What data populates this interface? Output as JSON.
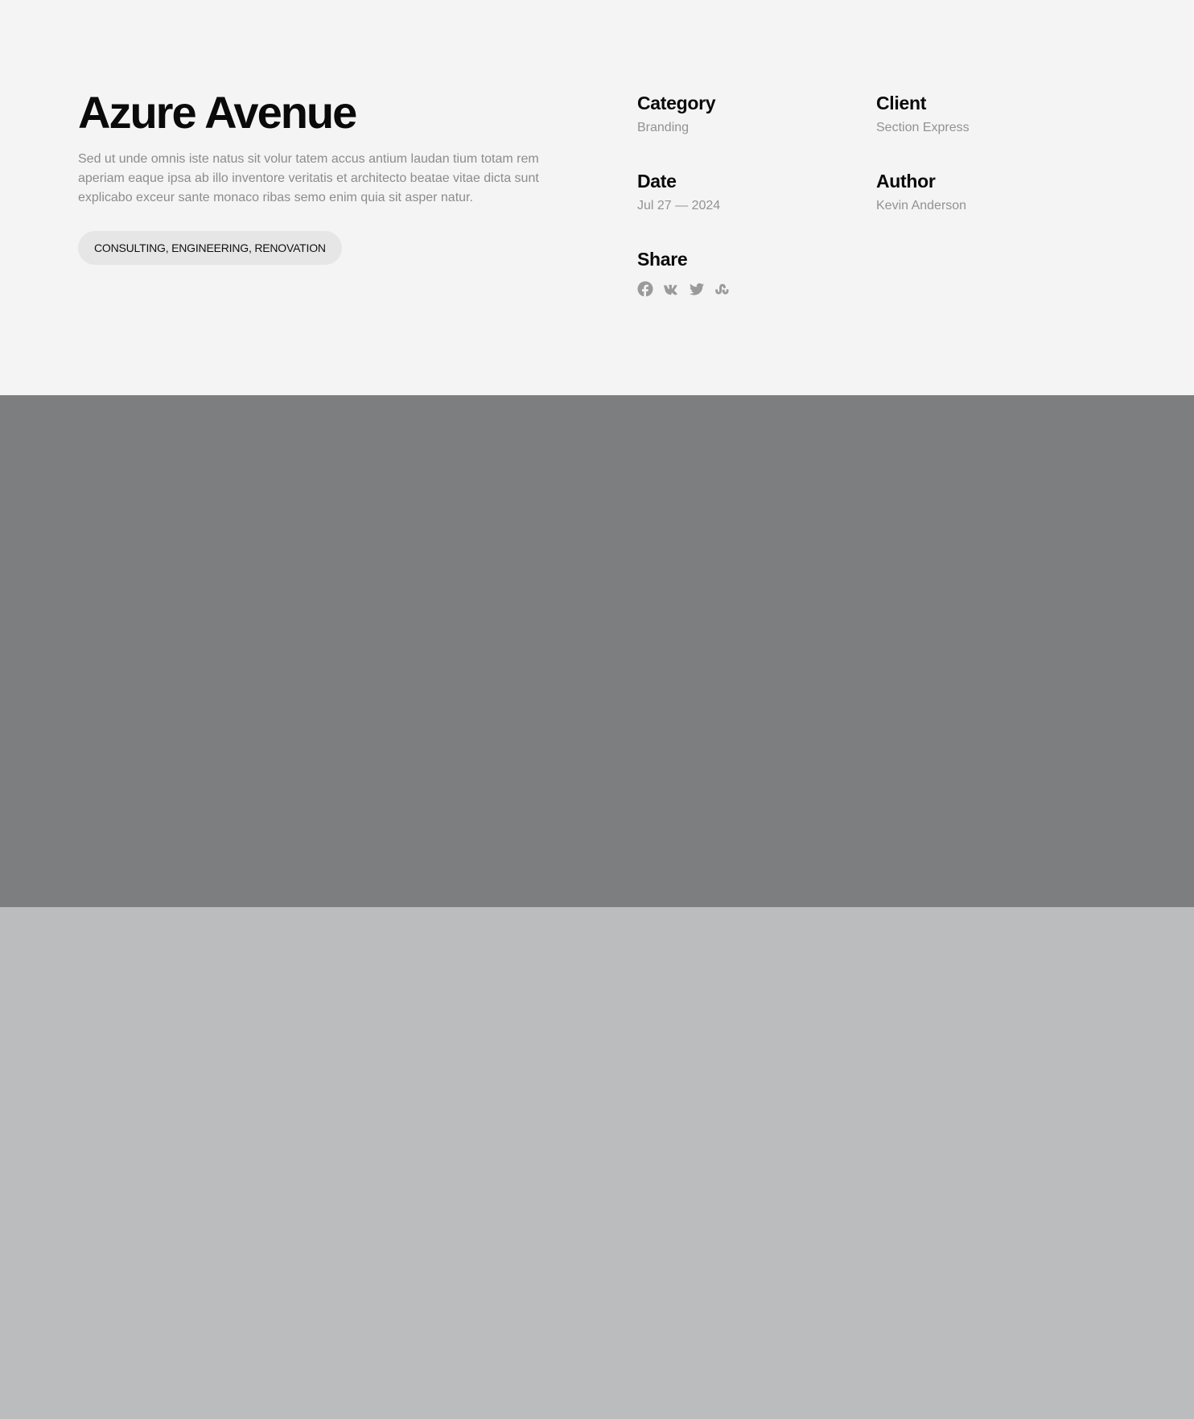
{
  "project": {
    "title": "Azure Avenue",
    "description": "Sed ut unde omnis iste natus sit volur tatem accus antium laudan tium totam rem aperiam eaque ipsa ab illo inventore veritatis et architecto beatae vitae dicta sunt explicabo exceur sante monaco ribas semo enim quia sit asper natur.",
    "tags": "CONSULTING, ENGINEERING, RENOVATION"
  },
  "meta": {
    "category": {
      "label": "Category",
      "value": "Branding"
    },
    "client": {
      "label": "Client",
      "value": "Section Express"
    },
    "date": {
      "label": "Date",
      "value": "Jul 27 — 2024"
    },
    "author": {
      "label": "Author",
      "value": "Kevin Anderson"
    },
    "share": {
      "label": "Share",
      "icons": [
        "facebook-icon",
        "vk-icon",
        "twitter-icon",
        "stumbleupon-icon"
      ]
    }
  },
  "colors": {
    "page_bg": "#f4f4f4",
    "pill_bg": "#e6e6e6",
    "heading": "#0a0a0a",
    "muted_text": "#8c8c8c",
    "icon_gray": "#9a9a9a",
    "image_band_dark": "#7d7e80",
    "image_band_light": "#bbbcbe"
  }
}
